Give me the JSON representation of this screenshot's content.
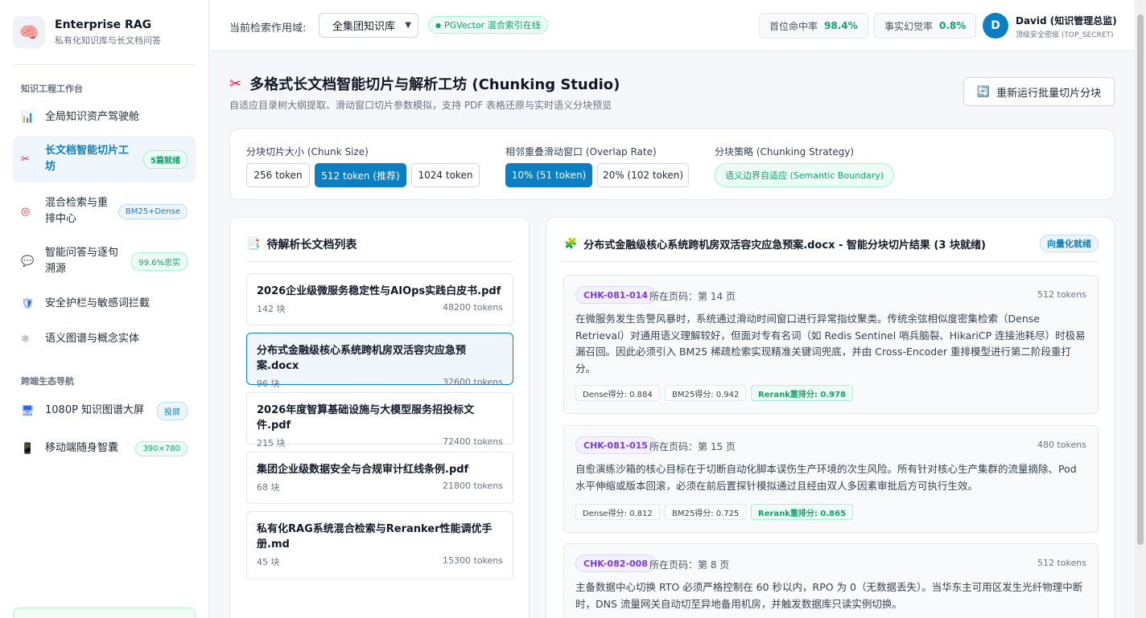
{
  "brand": {
    "title": "Enterprise RAG",
    "subtitle": "私有化知识库与长文档问答",
    "logo_icon": "brain-icon"
  },
  "sidebar": {
    "section1": "知识工程工作台",
    "section2": "跨端生态导航",
    "items": [
      {
        "label": "全局知识资产驾驶舱",
        "icon": "bar-chart-icon",
        "badge": ""
      },
      {
        "label": "长文档智能切片工坊",
        "icon": "scissors-icon",
        "badge": "5篇就绪"
      },
      {
        "label": "混合检索与重排中心",
        "icon": "target-icon",
        "badge": "BM25+Dense"
      },
      {
        "label": "智能问答与逐句溯源",
        "icon": "speech-bubble-icon",
        "badge": "99.6%忠实"
      },
      {
        "label": "安全护栏与敏感词拦截",
        "icon": "shield-icon",
        "badge": ""
      },
      {
        "label": "语义图谱与概念实体",
        "icon": "snowflake-icon",
        "badge": ""
      },
      {
        "label": "1080P 知识图谱大屏",
        "icon": "monitor-icon",
        "badge": "投屏"
      },
      {
        "label": "移动端随身智囊",
        "icon": "phone-icon",
        "badge": "390×780"
      }
    ]
  },
  "topbar": {
    "scope_label": "当前检索作用域:",
    "scope_value": "全集团知识库",
    "pg_status": "PGVector 混合索引在线",
    "metric1_label": "首位命中率",
    "metric1_value": "98.4%",
    "metric2_label": "事实幻觉率",
    "metric2_value": "0.8%",
    "avatar_letter": "D",
    "user_name": "David (知识管理总监)",
    "user_sub": "顶级安全密级 (TOP_SECRET)"
  },
  "header": {
    "title": "多格式长文档智能切片与解析工坊 (Chunking Studio)",
    "subtitle": "自适应目录树大纲提取、滑动窗口切片参数模拟，支持 PDF 表格还原与实时语义分块预览",
    "rerun_label": "重新运行批量切片分块"
  },
  "config": {
    "size_label": "分块切片大小 (Chunk Size)",
    "size_options": [
      "256 token",
      "512 token (推荐)",
      "1024 token"
    ],
    "overlap_label": "相邻重叠滑动窗口 (Overlap Rate)",
    "overlap_options": [
      "10% (51 token)",
      "20% (102 token)"
    ],
    "strategy_label": "分块策略 (Chunking Strategy)",
    "strategy_value": "语义边界自适应 (Semantic Boundary)"
  },
  "docs": {
    "title": "待解析长文档列表",
    "items": [
      {
        "name": "2026企业级微服务稳定性与AIOps实践白皮书.pdf",
        "chunks": "142 块",
        "tokens": "48200 tokens"
      },
      {
        "name": "分布式金融级核心系统跨机房双活容灾应急预案.docx",
        "chunks": "96 块",
        "tokens": "32600 tokens"
      },
      {
        "name": "2026年度智算基础设施与大模型服务招投标文件.pdf",
        "chunks": "215 块",
        "tokens": "72400 tokens"
      },
      {
        "name": "集团企业级数据安全与合规审计红线条例.pdf",
        "chunks": "68 块",
        "tokens": "21800 tokens"
      },
      {
        "name": "私有化RAG系统混合检索与Reranker性能调优手册.md",
        "chunks": "45 块",
        "tokens": "15300 tokens"
      }
    ]
  },
  "results": {
    "title": "分布式金融级核心系统跨机房双活容灾应急预案.docx - 智能分块切片结果 (3 块就绪)",
    "badge": "向量化就绪",
    "chunks": [
      {
        "id": "CHK-081-014",
        "page": "所在页码：第 14 页",
        "tokens": "512 tokens",
        "text": "在微服务发生告警风暴时，系统通过滑动时间窗口进行异常指纹聚类。传统余弦相似度密集检索（Dense Retrieval）对通用语义理解较好，但面对专有名词（如 Redis Sentinel 哨兵脑裂、HikariCP 连接池耗尽）时极易漏召回。因此必须引入 BM25 稀疏检索实现精准关键词兜底，并由 Cross-Encoder 重排模型进行第二阶段重打分。",
        "dense": "Dense得分: 0.884",
        "bm25": "BM25得分: 0.942",
        "rerank": "Rerank重排分: 0.978"
      },
      {
        "id": "CHK-081-015",
        "page": "所在页码：第 15 页",
        "tokens": "480 tokens",
        "text": "自愈演练沙箱的核心目标在于切断自动化脚本误伤生产环境的次生风险。所有针对核心生产集群的流量摘除、Pod 水平伸缩或版本回滚，必须在前后置探针模拟通过且经由双人多因素审批后方可执行生效。",
        "dense": "Dense得分: 0.812",
        "bm25": "BM25得分: 0.725",
        "rerank": "Rerank重排分: 0.865"
      },
      {
        "id": "CHK-082-008",
        "page": "所在页码：第 8 页",
        "tokens": "512 tokens",
        "text": "主备数据中心切换 RTO 必须严格控制在 60 秒以内，RPO 为 0（无数据丢失）。当华东主可用区发生光纤物理中断时，DNS 流量网关自动切至异地备用机房，并触发数据库只读实例切换。",
        "dense": "",
        "bm25": "",
        "rerank": ""
      }
    ]
  },
  "colors": {
    "accent": "#0b7fc2",
    "success": "#10a56b",
    "chunk_id": "#7c3aed"
  }
}
